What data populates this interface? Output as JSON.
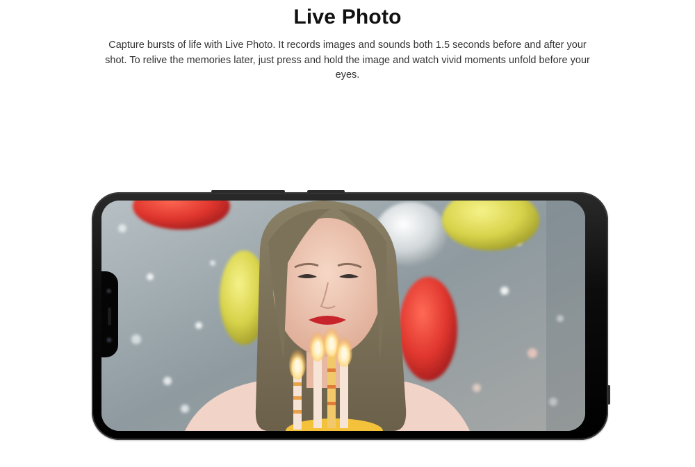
{
  "header": {
    "title": "Live Photo",
    "description": "Capture bursts of life with Live Photo. It records images and sounds both 1.5 seconds before and after your shot. To relive the memories later, just press and hold the image and watch vivid moments unfold before your eyes."
  },
  "colors": {
    "title_text": "#111111",
    "body_text": "#333333",
    "phone_body": "#0c0c0c",
    "lipstick": "#c8242c",
    "balloon_red": "#e0362e",
    "balloon_yellow": "#d7d34a"
  },
  "icons": [
    "front-camera-icon",
    "speaker-icon",
    "sensor-icon"
  ]
}
